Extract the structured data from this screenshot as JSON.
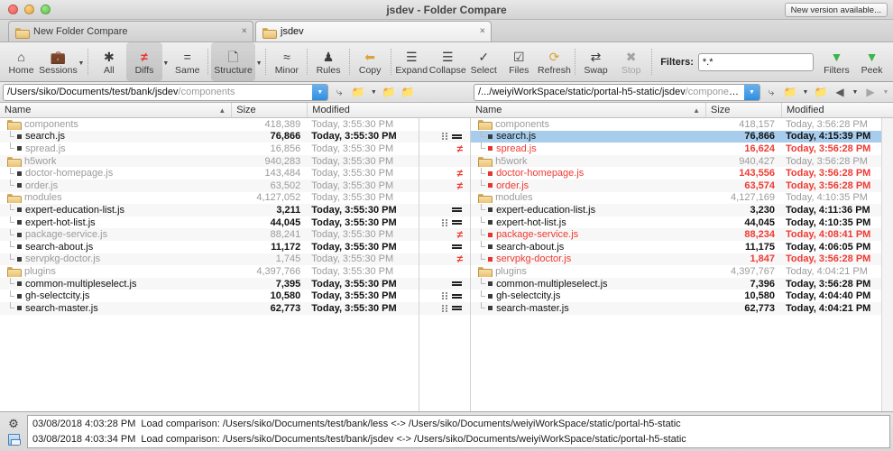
{
  "window": {
    "title": "jsdev - Folder Compare",
    "new_version_label": "New version available...",
    "traffic_lights": [
      "close-red",
      "minimize-yellow",
      "zoom-green"
    ]
  },
  "tabs": [
    {
      "label": "New Folder Compare",
      "close": "×",
      "active": false
    },
    {
      "label": "jsdev",
      "close": "×",
      "active": true
    }
  ],
  "toolbar": {
    "items": [
      {
        "label": "Home",
        "icon": "home-icon",
        "glyph": "⌂",
        "active": false,
        "disabled": false,
        "caret": false
      },
      {
        "label": "Sessions",
        "icon": "sessions-icon",
        "glyph": "▬",
        "active": false,
        "disabled": false,
        "caret": true
      },
      {
        "label": "All",
        "icon": "all-icon",
        "glyph": "✱",
        "active": false,
        "disabled": false,
        "caret": false
      },
      {
        "label": "Diffs",
        "icon": "diffs-icon",
        "glyph": "≠",
        "active": true,
        "disabled": false,
        "caret": true
      },
      {
        "label": "Same",
        "icon": "same-icon",
        "glyph": "=",
        "active": false,
        "disabled": false,
        "caret": false
      },
      {
        "label": "Structure",
        "icon": "structure-icon",
        "glyph": "❐",
        "active": true,
        "disabled": false,
        "caret": true
      },
      {
        "label": "Minor",
        "icon": "minor-icon",
        "glyph": "≈",
        "active": false,
        "disabled": false,
        "caret": false
      },
      {
        "label": "Rules",
        "icon": "rules-icon",
        "glyph": "♟",
        "active": false,
        "disabled": false,
        "caret": false
      },
      {
        "label": "Copy",
        "icon": "copy-icon",
        "glyph": "⇦",
        "active": false,
        "disabled": false,
        "caret": false
      },
      {
        "label": "Expand",
        "icon": "expand-icon",
        "glyph": "≡",
        "active": false,
        "disabled": false,
        "caret": false
      },
      {
        "label": "Collapse",
        "icon": "collapse-icon",
        "glyph": "≣",
        "active": false,
        "disabled": false,
        "caret": false
      },
      {
        "label": "Select",
        "icon": "select-icon",
        "glyph": "✓",
        "active": false,
        "disabled": false,
        "caret": false
      },
      {
        "label": "Files",
        "icon": "files-icon",
        "glyph": "☑",
        "active": false,
        "disabled": false,
        "caret": false
      },
      {
        "label": "Refresh",
        "icon": "refresh-icon",
        "glyph": "↻",
        "active": false,
        "disabled": false,
        "caret": false
      },
      {
        "label": "Swap",
        "icon": "swap-icon",
        "glyph": "⇄",
        "active": false,
        "disabled": false,
        "caret": false
      },
      {
        "label": "Stop",
        "icon": "stop-icon",
        "glyph": "⊗",
        "active": false,
        "disabled": true,
        "caret": false
      }
    ],
    "filters_label": "Filters:",
    "filters_value": "*.*",
    "filters_placeholder": "*.*",
    "right_items": [
      {
        "label": "Filters",
        "icon": "funnel-icon",
        "glyph": "▽"
      },
      {
        "label": "Peek",
        "icon": "peek-icon",
        "glyph": "▽"
      }
    ]
  },
  "left_pane": {
    "path_main": "/Users/siko/Documents/test/bank/jsdev",
    "path_tail": "/components",
    "path_icons": [
      "sync-icon",
      "open-folder-icon",
      "folder-dropdown-caret",
      "up-folder-icon",
      "browse-folders-icon"
    ],
    "columns": {
      "name": "Name",
      "size": "Size",
      "modified": "Modified",
      "sort": "▲"
    },
    "rows": [
      {
        "type": "folder",
        "name": "components",
        "size": "418,389",
        "modified": "Today, 3:55:30 PM",
        "tone": "grey",
        "depth": 0,
        "last": false,
        "selected": false
      },
      {
        "type": "file",
        "name": "search.js",
        "size": "76,866",
        "modified": "Today, 3:55:30 PM",
        "tone": "black",
        "depth": 1,
        "last": false,
        "selected": false
      },
      {
        "type": "file",
        "name": "spread.js",
        "size": "16,856",
        "modified": "Today, 3:55:30 PM",
        "tone": "grey",
        "depth": 1,
        "last": true,
        "selected": false
      },
      {
        "type": "folder",
        "name": "h5work",
        "size": "940,283",
        "modified": "Today, 3:55:30 PM",
        "tone": "grey",
        "depth": 0,
        "last": false,
        "selected": false
      },
      {
        "type": "file",
        "name": "doctor-homepage.js",
        "size": "143,484",
        "modified": "Today, 3:55:30 PM",
        "tone": "grey",
        "depth": 1,
        "last": false,
        "selected": false
      },
      {
        "type": "file",
        "name": "order.js",
        "size": "63,502",
        "modified": "Today, 3:55:30 PM",
        "tone": "grey",
        "depth": 1,
        "last": true,
        "selected": false
      },
      {
        "type": "folder",
        "name": "modules",
        "size": "4,127,052",
        "modified": "Today, 3:55:30 PM",
        "tone": "grey",
        "depth": 0,
        "last": false,
        "selected": false
      },
      {
        "type": "file",
        "name": "expert-education-list.js",
        "size": "3,211",
        "modified": "Today, 3:55:30 PM",
        "tone": "black",
        "depth": 1,
        "last": false,
        "selected": false
      },
      {
        "type": "file",
        "name": "expert-hot-list.js",
        "size": "44,045",
        "modified": "Today, 3:55:30 PM",
        "tone": "black",
        "depth": 1,
        "last": false,
        "selected": false
      },
      {
        "type": "file",
        "name": "package-service.js",
        "size": "88,241",
        "modified": "Today, 3:55:30 PM",
        "tone": "grey",
        "depth": 1,
        "last": false,
        "selected": false
      },
      {
        "type": "file",
        "name": "search-about.js",
        "size": "11,172",
        "modified": "Today, 3:55:30 PM",
        "tone": "black",
        "depth": 1,
        "last": false,
        "selected": false
      },
      {
        "type": "file",
        "name": "servpkg-doctor.js",
        "size": "1,745",
        "modified": "Today, 3:55:30 PM",
        "tone": "grey",
        "depth": 1,
        "last": true,
        "selected": false
      },
      {
        "type": "folder",
        "name": "plugins",
        "size": "4,397,766",
        "modified": "Today, 3:55:30 PM",
        "tone": "grey",
        "depth": 0,
        "last": false,
        "selected": false
      },
      {
        "type": "file",
        "name": "common-multipleselect.js",
        "size": "7,395",
        "modified": "Today, 3:55:30 PM",
        "tone": "black",
        "depth": 1,
        "last": false,
        "selected": false
      },
      {
        "type": "file",
        "name": "gh-selectcity.js",
        "size": "10,580",
        "modified": "Today, 3:55:30 PM",
        "tone": "black",
        "depth": 1,
        "last": false,
        "selected": false
      },
      {
        "type": "file",
        "name": "search-master.js",
        "size": "62,773",
        "modified": "Today, 3:55:30 PM",
        "tone": "black",
        "depth": 1,
        "last": true,
        "selected": false
      }
    ]
  },
  "center_markers": [
    {
      "marker": "none"
    },
    {
      "marker": "bin-eq"
    },
    {
      "marker": "neq"
    },
    {
      "marker": "none"
    },
    {
      "marker": "neq"
    },
    {
      "marker": "neq"
    },
    {
      "marker": "none"
    },
    {
      "marker": "eq"
    },
    {
      "marker": "bin-eq"
    },
    {
      "marker": "neq"
    },
    {
      "marker": "eq"
    },
    {
      "marker": "neq"
    },
    {
      "marker": "none"
    },
    {
      "marker": "eq"
    },
    {
      "marker": "bin-eq"
    },
    {
      "marker": "bin-eq"
    }
  ],
  "right_pane": {
    "path_main": "/.../weiyiWorkSpace/static/portal-h5-static/jsdev",
    "path_tail": "/components",
    "path_icons": [
      "sync-icon",
      "open-folder-icon",
      "folder-dropdown-caret",
      "up-folder-icon",
      "back-icon",
      "back-dropdown-caret",
      "forward-icon",
      "forward-dropdown-caret"
    ],
    "columns": {
      "name": "Name",
      "size": "Size",
      "modified": "Modified",
      "sort": "▲"
    },
    "rows": [
      {
        "type": "folder",
        "name": "components",
        "size": "418,157",
        "modified": "Today, 3:56:28 PM",
        "tone": "grey",
        "depth": 0,
        "last": false,
        "selected": false
      },
      {
        "type": "file",
        "name": "search.js",
        "size": "76,866",
        "modified": "Today, 4:15:39 PM",
        "tone": "black",
        "depth": 1,
        "last": false,
        "selected": true
      },
      {
        "type": "file",
        "name": "spread.js",
        "size": "16,624",
        "modified": "Today, 3:56:28 PM",
        "tone": "red",
        "depth": 1,
        "last": true,
        "selected": false
      },
      {
        "type": "folder",
        "name": "h5work",
        "size": "940,427",
        "modified": "Today, 3:56:28 PM",
        "tone": "grey",
        "depth": 0,
        "last": false,
        "selected": false
      },
      {
        "type": "file",
        "name": "doctor-homepage.js",
        "size": "143,556",
        "modified": "Today, 3:56:28 PM",
        "tone": "red",
        "depth": 1,
        "last": false,
        "selected": false
      },
      {
        "type": "file",
        "name": "order.js",
        "size": "63,574",
        "modified": "Today, 3:56:28 PM",
        "tone": "red",
        "depth": 1,
        "last": true,
        "selected": false
      },
      {
        "type": "folder",
        "name": "modules",
        "size": "4,127,169",
        "modified": "Today, 4:10:35 PM",
        "tone": "grey",
        "depth": 0,
        "last": false,
        "selected": false
      },
      {
        "type": "file",
        "name": "expert-education-list.js",
        "size": "3,230",
        "modified": "Today, 4:11:36 PM",
        "tone": "black",
        "depth": 1,
        "last": false,
        "selected": false
      },
      {
        "type": "file",
        "name": "expert-hot-list.js",
        "size": "44,045",
        "modified": "Today, 4:10:35 PM",
        "tone": "black",
        "depth": 1,
        "last": false,
        "selected": false
      },
      {
        "type": "file",
        "name": "package-service.js",
        "size": "88,234",
        "modified": "Today, 4:08:41 PM",
        "tone": "red",
        "depth": 1,
        "last": false,
        "selected": false
      },
      {
        "type": "file",
        "name": "search-about.js",
        "size": "11,175",
        "modified": "Today, 4:06:05 PM",
        "tone": "black",
        "depth": 1,
        "last": false,
        "selected": false
      },
      {
        "type": "file",
        "name": "servpkg-doctor.js",
        "size": "1,847",
        "modified": "Today, 3:56:28 PM",
        "tone": "red",
        "depth": 1,
        "last": true,
        "selected": false
      },
      {
        "type": "folder",
        "name": "plugins",
        "size": "4,397,767",
        "modified": "Today, 4:04:21 PM",
        "tone": "grey",
        "depth": 0,
        "last": false,
        "selected": false
      },
      {
        "type": "file",
        "name": "common-multipleselect.js",
        "size": "7,396",
        "modified": "Today, 3:56:28 PM",
        "tone": "black",
        "depth": 1,
        "last": false,
        "selected": false
      },
      {
        "type": "file",
        "name": "gh-selectcity.js",
        "size": "10,580",
        "modified": "Today, 4:04:40 PM",
        "tone": "black",
        "depth": 1,
        "last": false,
        "selected": false
      },
      {
        "type": "file",
        "name": "search-master.js",
        "size": "62,773",
        "modified": "Today, 4:04:21 PM",
        "tone": "black",
        "depth": 1,
        "last": true,
        "selected": false
      }
    ]
  },
  "status": {
    "icons": [
      "gear-icon",
      "save-icon"
    ],
    "log": [
      {
        "timestamp": "03/08/2018 4:03:28 PM",
        "message": "Load comparison: /Users/siko/Documents/test/bank/less <-> /Users/siko/Documents/weiyiWorkSpace/static/portal-h5-static"
      },
      {
        "timestamp": "03/08/2018 4:03:34 PM",
        "message": "Load comparison: /Users/siko/Documents/test/bank/jsdev <-> /Users/siko/Documents/weiyiWorkSpace/static/portal-h5-static"
      }
    ]
  },
  "colors": {
    "diff_red": "#ef3b33",
    "selection_blue": "#a8cdec",
    "muted_grey": "#9b9b9b",
    "accent_blue": "#2f8ee0"
  }
}
